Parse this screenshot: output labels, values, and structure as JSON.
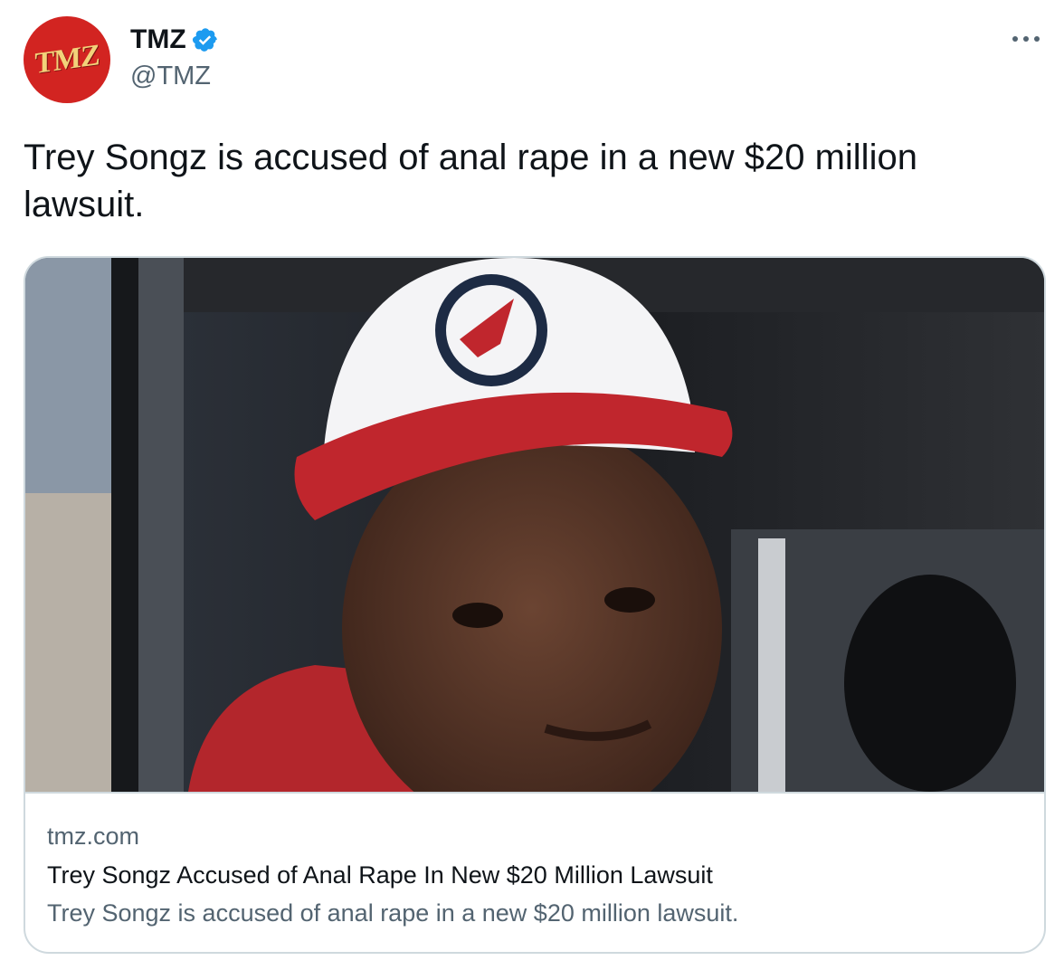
{
  "author": {
    "avatar_text": "TMZ",
    "display_name": "TMZ",
    "handle": "@TMZ",
    "verified": true
  },
  "tweet": {
    "text": "Trey Songz is accused of anal rape in a new $20 million lawsuit."
  },
  "card": {
    "image_icon": "news-photo",
    "domain": "tmz.com",
    "title": "Trey Songz Accused of Anal Rape In New $20 Million Lawsuit",
    "description": "Trey Songz is accused of anal rape in a new $20 million lawsuit."
  },
  "icons": {
    "verified": "verified-badge-icon",
    "more": "more-options-icon"
  },
  "colors": {
    "brand_red": "#d22421",
    "verified_blue": "#1d9bf0",
    "text_primary": "#0f1419",
    "text_secondary": "#536471",
    "border": "#cfd9de"
  }
}
